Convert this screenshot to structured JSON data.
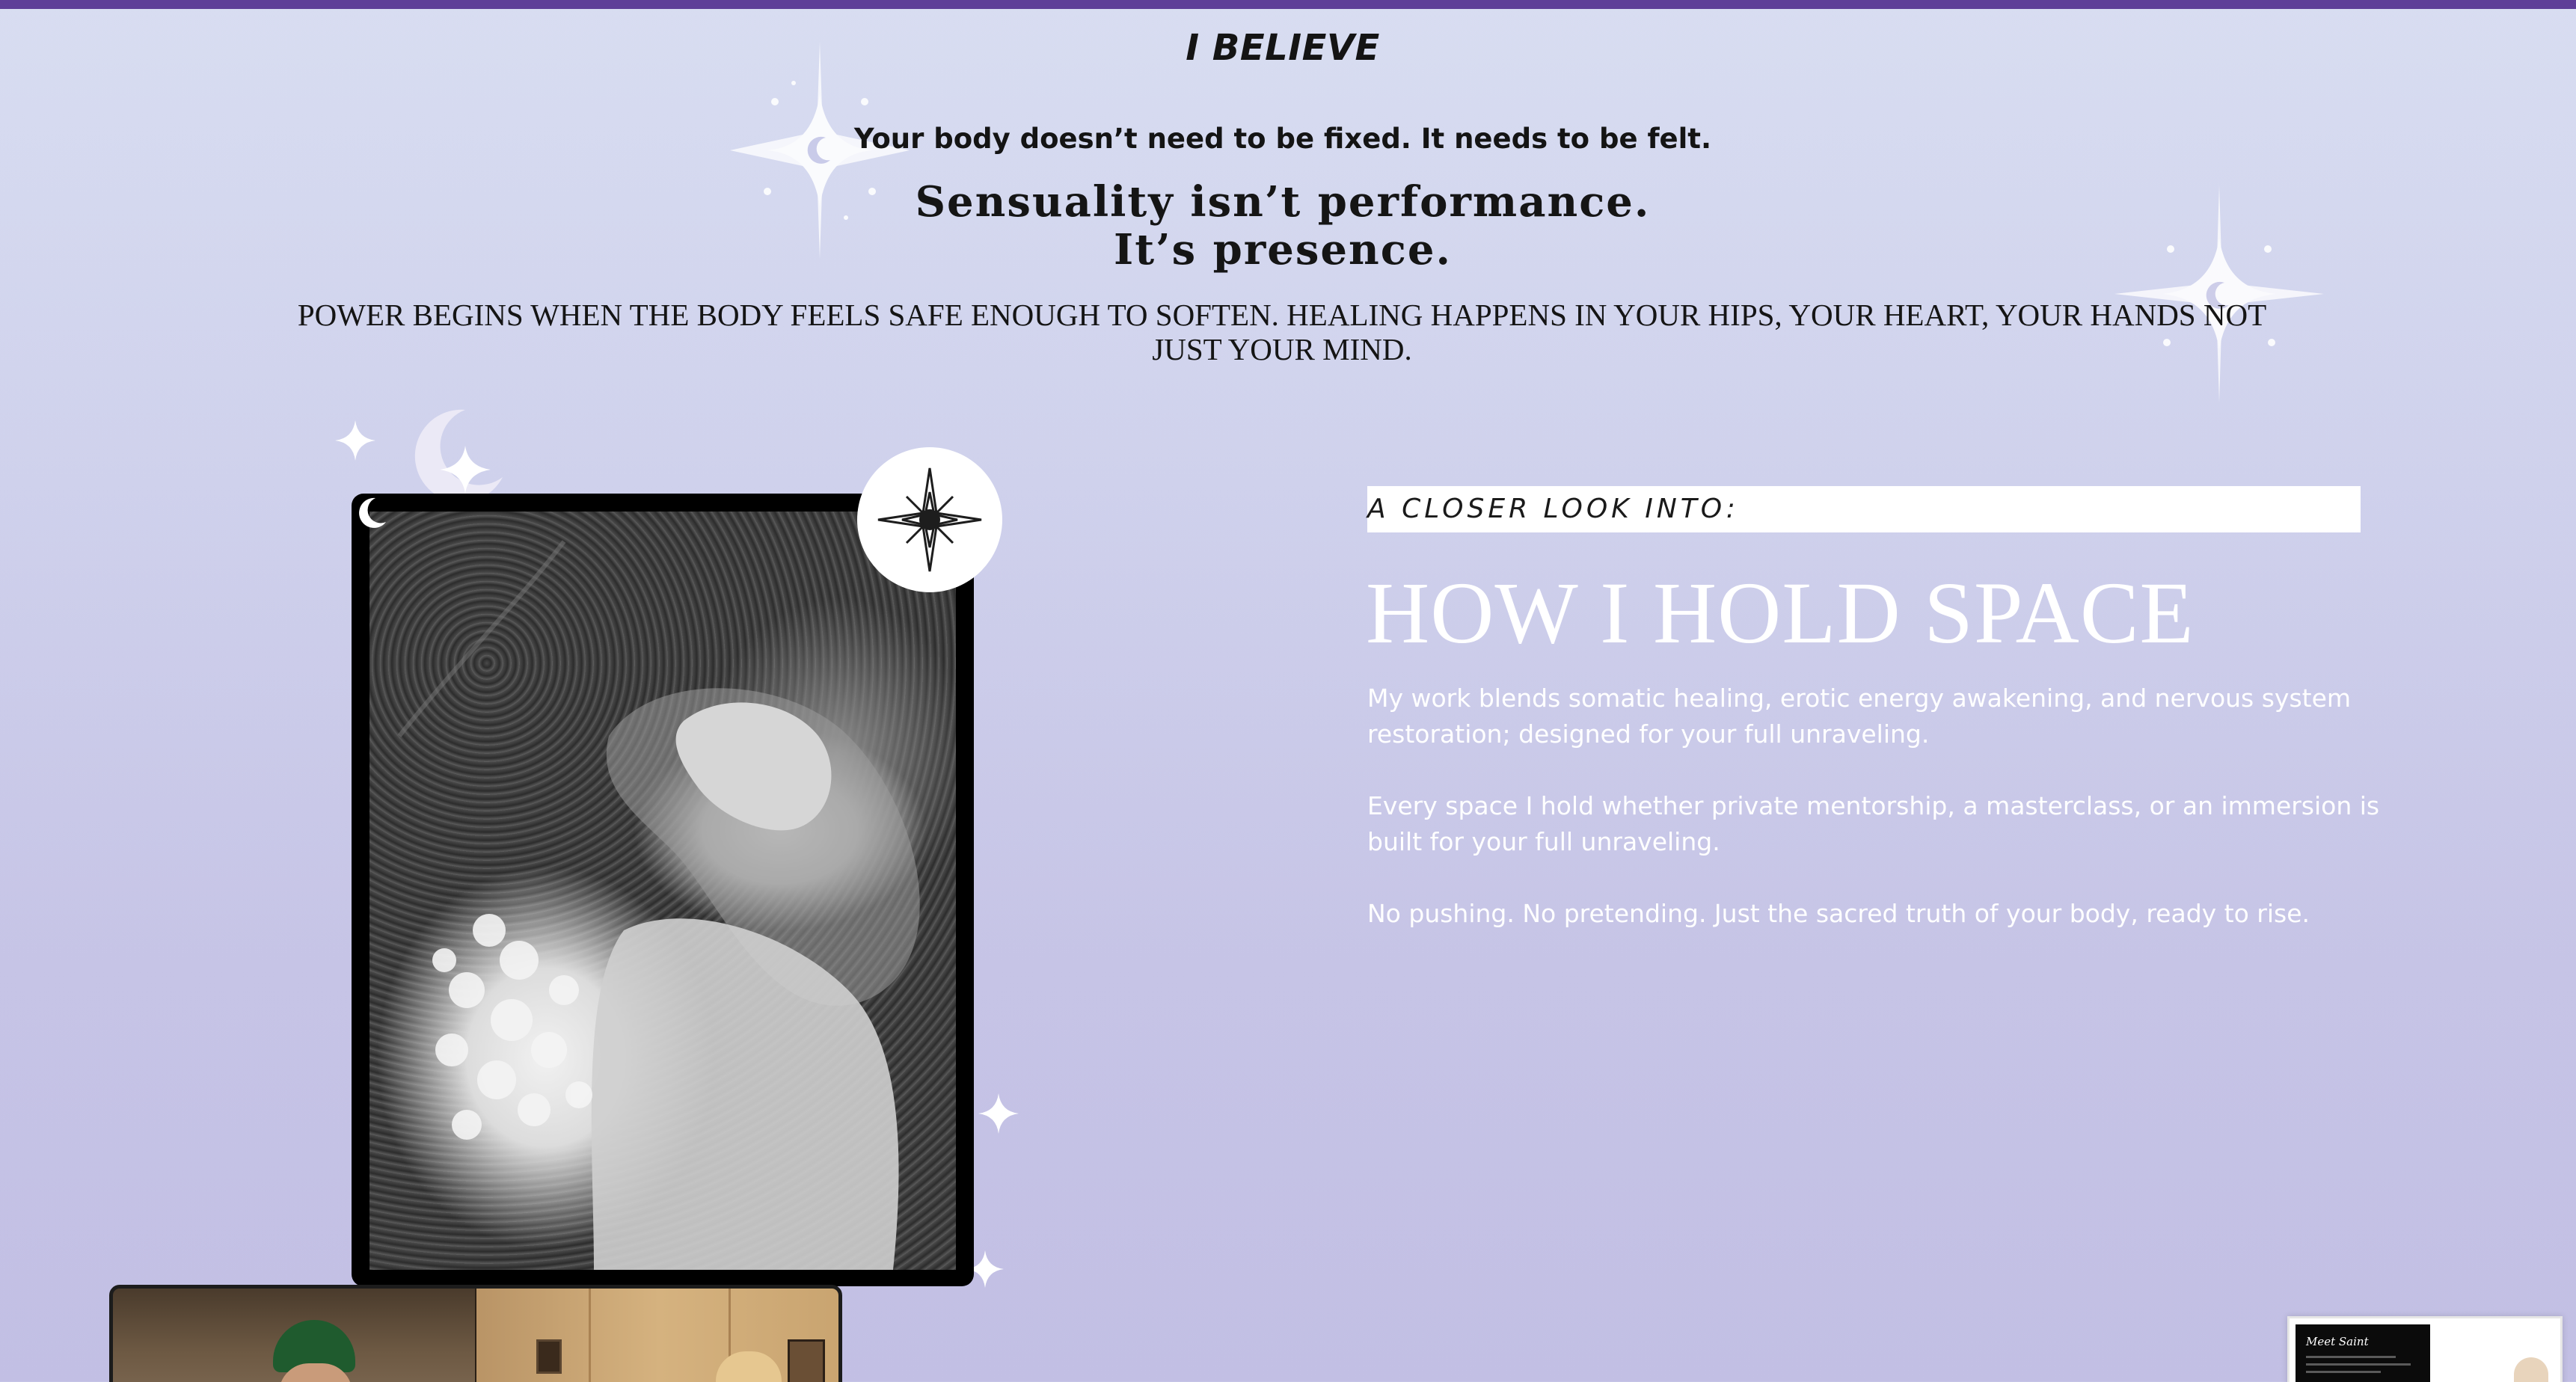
{
  "belief": {
    "title": "I BELIEVE",
    "line": "Your body doesn’t need to be fixed. It needs to be felt.",
    "headline_line1": "Sensuality isn’t performance.",
    "headline_line2": "It’s presence.",
    "power_statement": "POWER BEGINS WHEN THE BODY FEELS SAFE ENOUGH TO SOFTEN. HEALING HAPPENS IN YOUR HIPS, YOUR HEART, YOUR HANDS NOT JUST YOUR MIND."
  },
  "approach": {
    "label": "A CLOSER LOOK INTO:",
    "title": "HOW I HOLD SPACE",
    "paragraph1": "My work blends somatic healing, erotic energy awakening, and nervous system restoration; designed for your full unraveling.",
    "paragraph2": "Every space I hold whether private mentorship, a masterclass, or an immersion is built for your full unraveling.",
    "paragraph3": "No pushing. No pretending. Just the sacred truth of your body, ready to rise."
  },
  "mini_preview": {
    "title": "Meet Saint"
  },
  "colors": {
    "topbar": "#5e3f98",
    "background_top": "#d8ddf1",
    "background_bottom": "#c2bfe4",
    "title_text": "#ffffff",
    "body_text": "#141414"
  },
  "icons": [
    "sparkle-moon-icon",
    "sparkle-icon",
    "moon-icon",
    "compass-star-icon"
  ]
}
